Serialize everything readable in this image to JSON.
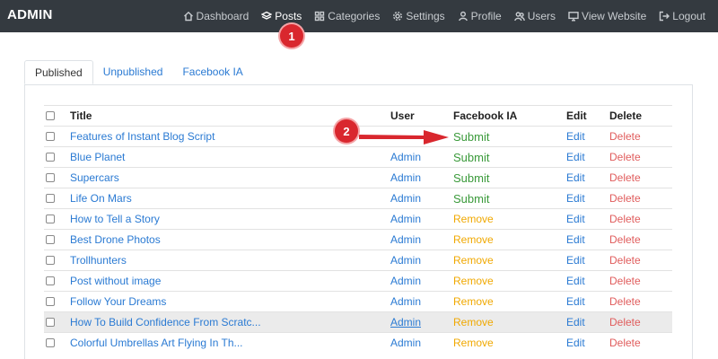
{
  "brand": "ADMIN",
  "nav": [
    {
      "label": "Dashboard",
      "icon": "home-icon"
    },
    {
      "label": "Posts",
      "icon": "layers-icon",
      "active": true
    },
    {
      "label": "Categories",
      "icon": "grid-icon"
    },
    {
      "label": "Settings",
      "icon": "gear-icon"
    },
    {
      "label": "Profile",
      "icon": "user-icon"
    },
    {
      "label": "Users",
      "icon": "users-icon"
    },
    {
      "label": "View Website",
      "icon": "monitor-icon"
    },
    {
      "label": "Logout",
      "icon": "logout-icon"
    }
  ],
  "annotations": {
    "badge1": "1",
    "badge2": "2",
    "badge_color": "#d9272e"
  },
  "tabs": [
    "Published",
    "Unpublished",
    "Facebook IA"
  ],
  "table": {
    "headers": {
      "title": "Title",
      "user": "User",
      "fb": "Facebook IA",
      "edit": "Edit",
      "delete": "Delete"
    },
    "rows": [
      {
        "title": "Features of Instant Blog Script",
        "user": "",
        "fb": "Submit",
        "edit": "Edit",
        "delete": "Delete"
      },
      {
        "title": "Blue Planet",
        "user": "Admin",
        "fb": "Submit",
        "edit": "Edit",
        "delete": "Delete"
      },
      {
        "title": "Supercars",
        "user": "Admin",
        "fb": "Submit",
        "edit": "Edit",
        "delete": "Delete"
      },
      {
        "title": "Life On Mars",
        "user": "Admin",
        "fb": "Submit",
        "edit": "Edit",
        "delete": "Delete"
      },
      {
        "title": "How to Tell a Story",
        "user": "Admin",
        "fb": "Remove",
        "edit": "Edit",
        "delete": "Delete"
      },
      {
        "title": "Best Drone Photos",
        "user": "Admin",
        "fb": "Remove",
        "edit": "Edit",
        "delete": "Delete"
      },
      {
        "title": "Trollhunters",
        "user": "Admin",
        "fb": "Remove",
        "edit": "Edit",
        "delete": "Delete"
      },
      {
        "title": "Post without image",
        "user": "Admin",
        "fb": "Remove",
        "edit": "Edit",
        "delete": "Delete"
      },
      {
        "title": "Follow Your Dreams",
        "user": "Admin",
        "fb": "Remove",
        "edit": "Edit",
        "delete": "Delete"
      },
      {
        "title": "How To Build Confidence From Scratc...",
        "user": "Admin",
        "fb": "Remove",
        "edit": "Edit",
        "delete": "Delete",
        "hover": true
      },
      {
        "title": "Colorful Umbrellas Art Flying In Th...",
        "user": "Admin",
        "fb": "Remove",
        "edit": "Edit",
        "delete": "Delete"
      }
    ]
  }
}
